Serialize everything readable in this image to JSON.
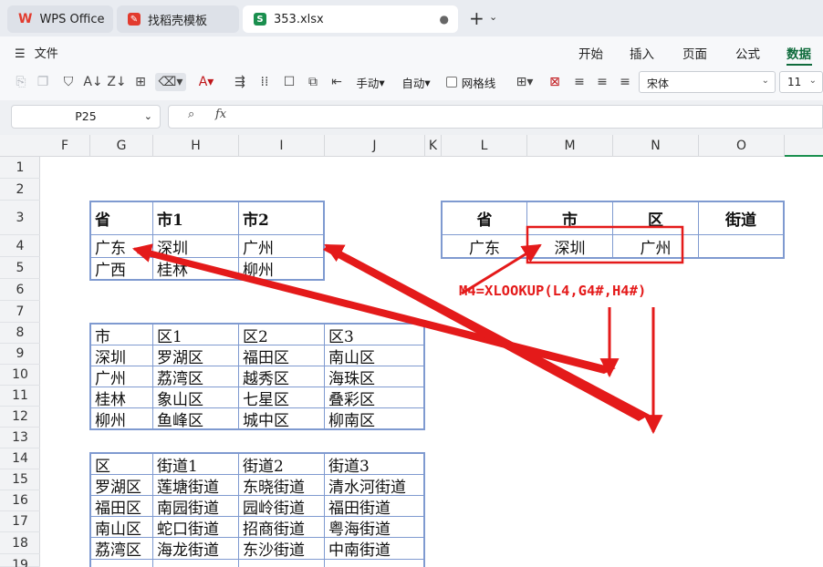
{
  "tabs": [
    {
      "label": "WPS Office"
    },
    {
      "label": "找稻壳模板"
    },
    {
      "label": "353.xlsx"
    }
  ],
  "menu": {
    "file": "文件",
    "tabs": [
      "开始",
      "插入",
      "页面",
      "公式",
      "数据"
    ],
    "active_tab": "数据"
  },
  "toolbar": {
    "manual": "手动",
    "auto": "自动",
    "gridlines": "网格线",
    "font": "宋体",
    "size": "11"
  },
  "formula_bar": {
    "cell_ref": "P25",
    "fx": "fx",
    "value": ""
  },
  "columns": [
    "F",
    "G",
    "H",
    "I",
    "J",
    "K",
    "L",
    "M",
    "N",
    "O"
  ],
  "rows": [
    "1",
    "2",
    "3",
    "4",
    "5",
    "6",
    "7",
    "8",
    "9",
    "10",
    "11",
    "12",
    "13",
    "14",
    "15",
    "16",
    "17",
    "18",
    "19"
  ],
  "table1": {
    "header": [
      "省",
      "市1",
      "市2"
    ],
    "rows": [
      [
        "广东",
        "深圳",
        "广州"
      ],
      [
        "广西",
        "桂林",
        "柳州"
      ]
    ]
  },
  "table2": {
    "header": [
      "市",
      "区1",
      "区2",
      "区3"
    ],
    "rows": [
      [
        "深圳",
        "罗湖区",
        "福田区",
        "南山区"
      ],
      [
        "广州",
        "荔湾区",
        "越秀区",
        "海珠区"
      ],
      [
        "桂林",
        "象山区",
        "七星区",
        "叠彩区"
      ],
      [
        "柳州",
        "鱼峰区",
        "城中区",
        "柳南区"
      ]
    ]
  },
  "table3": {
    "header": [
      "区",
      "街道1",
      "街道2",
      "街道3"
    ],
    "rows": [
      [
        "罗湖区",
        "莲塘街道",
        "东晓街道",
        "清水河街道"
      ],
      [
        "福田区",
        "南园街道",
        "园岭街道",
        "福田街道"
      ],
      [
        "南山区",
        "蛇口街道",
        "招商街道",
        "粤海街道"
      ],
      [
        "荔湾区",
        "海龙街道",
        "东沙街道",
        "中南街道"
      ]
    ]
  },
  "result_table": {
    "header": [
      "省",
      "市",
      "区",
      "街道"
    ],
    "row": [
      "广东",
      "深圳",
      "广州",
      ""
    ]
  },
  "annotation": {
    "formula": "M4=XLOOKUP(L4,G4#,H4#)",
    "color": "#e41a1a"
  },
  "colors": {
    "accent": "#0f6b3c",
    "table_border": "#7f9ad0",
    "wps_red": "#e23b2e"
  }
}
